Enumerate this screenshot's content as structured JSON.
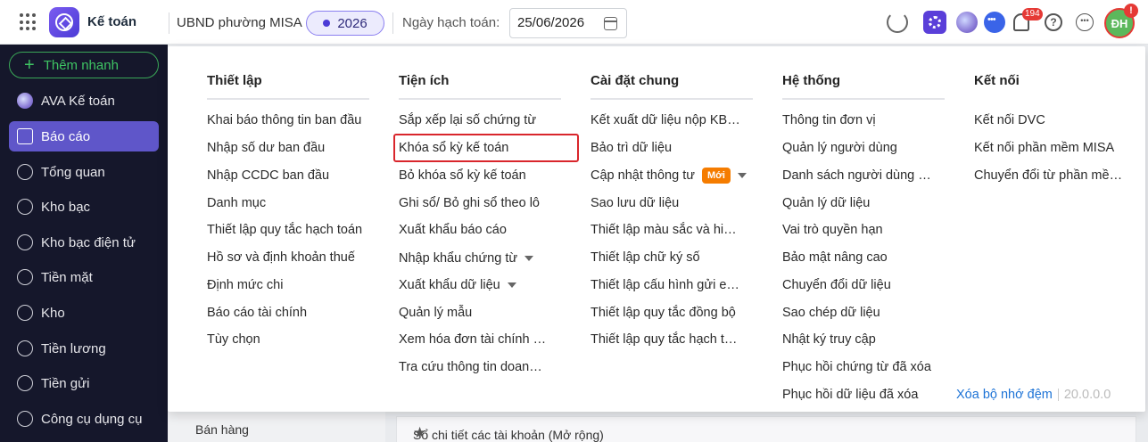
{
  "header": {
    "app_name": "Kế toán",
    "org_name": "UBND phường MISA",
    "year": "2026",
    "date_label": "Ngày hạch toán:",
    "date_value": "25/06/2026",
    "notification_count": "194",
    "user_initials": "ĐH",
    "user_alert": "!"
  },
  "sidebar": {
    "quick_add": "Thêm nhanh",
    "items": [
      {
        "label": "AVA Kế toán",
        "icon": "ava-icon"
      },
      {
        "label": "Báo cáo",
        "icon": "report-icon",
        "active": true
      },
      {
        "label": "Tổng quan",
        "icon": "overview-icon"
      },
      {
        "label": "Kho bạc",
        "icon": "treasury-icon"
      },
      {
        "label": "Kho bạc điện tử",
        "icon": "e-treasury-icon"
      },
      {
        "label": "Tiền mặt",
        "icon": "cash-icon"
      },
      {
        "label": "Kho",
        "icon": "warehouse-icon"
      },
      {
        "label": "Tiền lương",
        "icon": "salary-icon"
      },
      {
        "label": "Tiền gửi",
        "icon": "deposit-icon"
      },
      {
        "label": "Công cụ dụng cụ",
        "icon": "tools-icon"
      }
    ]
  },
  "menu": {
    "columns": [
      {
        "title": "Thiết lập",
        "items": [
          "Khai báo thông tin ban đầu",
          "Nhập số dư ban đầu",
          "Nhập CCDC ban đầu",
          "Danh mục",
          "Thiết lập quy tắc hạch toán",
          "Hồ sơ và định khoản thuế",
          "Định mức chi",
          "Báo cáo tài chính",
          "Tùy chọn"
        ]
      },
      {
        "title": "Tiện ích",
        "items": [
          "Sắp xếp lại số chứng từ",
          "Khóa sổ kỳ kế toán",
          "Bỏ khóa sổ kỳ kế toán",
          "Ghi sổ/ Bỏ ghi sổ theo lô",
          "Xuất khẩu báo cáo",
          "Nhập khẩu chứng từ",
          "Xuất khẩu dữ liệu",
          "Quản lý mẫu",
          "Xem hóa đơn tài chính điện tử",
          "Tra cứu thông tin doanh nghiệp"
        ]
      },
      {
        "title": "Cài đặt chung",
        "items": [
          "Kết xuất dữ liệu nộp KBNN",
          "Bảo trì dữ liệu",
          "Cập nhật thông tư",
          "Sao lưu dữ liệu",
          "Thiết lập màu sắc và hiển thị",
          "Thiết lập chữ ký số",
          "Thiết lập cấu hình gửi email",
          "Thiết lập quy tắc đồng bộ",
          "Thiết lập quy tắc hạch toán"
        ],
        "new_badge": "Mới"
      },
      {
        "title": "Hệ thống",
        "items": [
          "Thông tin đơn vị",
          "Quản lý người dùng",
          "Danh sách người dùng đăng nhập",
          "Quản lý dữ liệu",
          "Vai trò quyền hạn",
          "Bảo mật nâng cao",
          "Chuyển đổi dữ liệu",
          "Sao chép dữ liệu",
          "Nhật ký truy cập",
          "Phục hồi chứng từ đã xóa",
          "Phục hồi dữ liệu đã xóa"
        ]
      },
      {
        "title": "Kết nối",
        "items": [
          "Kết nối DVC",
          "Kết nối phần mềm MISA",
          "Chuyển đổi từ phần mềm khác"
        ]
      }
    ],
    "clear_cache": "Xóa bộ nhớ đệm",
    "version": "20.0.0.0"
  },
  "background": {
    "left_item": "Bán hàng",
    "right_item": "Sổ chi tiết các tài khoản (Mở rộng)"
  },
  "colors": {
    "accent": "#5f56c9",
    "sidebar_bg": "#15172b",
    "highlight_border": "#d9262c",
    "new_badge": "#f57c00",
    "link": "#1d73d6"
  }
}
